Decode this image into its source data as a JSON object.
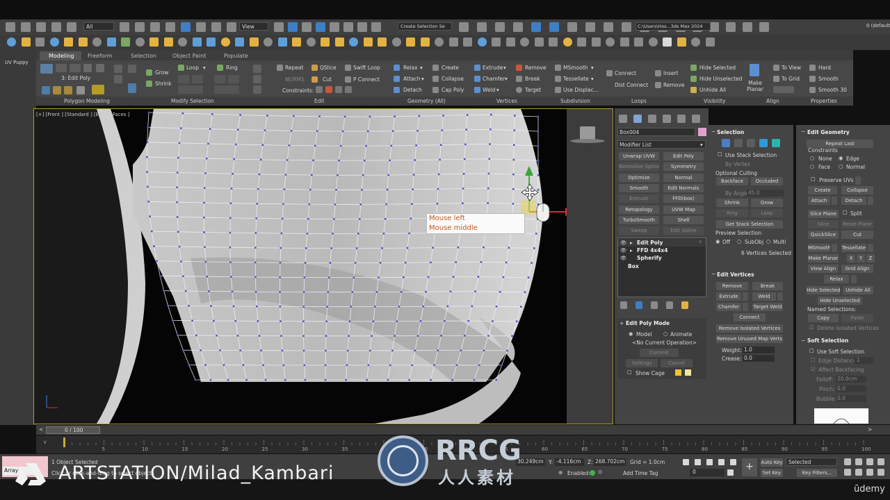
{
  "toolbar1": {
    "filter": "All",
    "view": "View",
    "selection_set": "Create Selection Se",
    "project_path": "C:\\Users\\Hos...3ds Max 2024",
    "user_count": "0 (default)"
  },
  "left_panel": {
    "label": "UV Puppy"
  },
  "ribbon": {
    "tabs": [
      "Modeling",
      "Freeform",
      "Selection",
      "Object Paint",
      "Populate"
    ],
    "edit_poly_label": "3: Edit Poly",
    "grow": "Grow",
    "shrink": "Shrink",
    "loop": "Loop",
    "ring": "Ring",
    "repeat": "Repeat",
    "qslice": "QSlice",
    "swift_loop": "Swift Loop",
    "nurms": "NURMS",
    "cut": "Cut",
    "p_connect": "P Connect",
    "constraints": "Constraints:",
    "relax": "Relax",
    "create": "Create",
    "attach": "Attach",
    "collapse": "Collapse",
    "detach": "Detach",
    "cap_poly": "Cap Poly",
    "extrude": "Extrude",
    "remove": "Remove",
    "chamfer": "Chamfer",
    "break": "Break",
    "weld": "Weld",
    "target": "Target",
    "msmooth": "MSmooth",
    "tessellate": "Tessellate",
    "use_displac": "Use Displac...",
    "connect": "Connect",
    "dist_connect": "Dist Connect",
    "insert": "Insert",
    "remove2": "Remove",
    "hide_selected": "Hide Selected",
    "hide_unselected": "Hide Unselected",
    "unhide_all": "Unhide All",
    "make_planar": "Make Planar",
    "to_view": "To View",
    "to_grid": "To Grid",
    "hard": "Hard",
    "smooth": "Smooth",
    "smooth30": "Smooth 30",
    "groups": [
      "Polygon Modeling",
      "Modify Selection",
      "Edit",
      "Geometry (All)",
      "Vertices",
      "Subdivision",
      "Loops",
      "Visibility",
      "Align",
      "Properties"
    ]
  },
  "viewport": {
    "label": "[+] [Front ] [Standard ] [Edged Faces ]",
    "tooltip_left": "Mouse left",
    "tooltip_middle": "Mouse middle"
  },
  "modifier_panel": {
    "object_name": "Box004",
    "modifier_list": "Modifier List",
    "buttons": [
      "Unwrap UVW",
      "Edit Poly",
      "Normalize Spline",
      "Symmetry",
      "Optimize",
      "Normal",
      "Smooth",
      "Edit Normals",
      "Extrude",
      "FFD(box)",
      "Retopology",
      "UVW Map",
      "TurboSmooth",
      "Shell",
      "Sweep",
      "Edit Spline"
    ],
    "stack": [
      "Edit Poly",
      "FFD 4x4x4",
      "Spherify",
      "Box"
    ],
    "edit_poly_mode": "Edit Poly Mode",
    "model": "Model",
    "animate": "Animate",
    "no_current_op": "<No Current Operation>",
    "commit": "Commit",
    "settings": "Settings",
    "cancel": "Cancel",
    "show_cage": "Show Cage"
  },
  "selection_panel": {
    "title": "Selection",
    "use_stack": "Use Stack Selection",
    "by_vertex": "By Vertex",
    "optional_culling": "Optional Culling",
    "backface": "Backface",
    "occluded": "Occluded",
    "by_angle": "By Angle:",
    "angle_value": "45.0",
    "shrink": "Shrink",
    "grow": "Grow",
    "ring": "Ring",
    "loop": "Loop",
    "get_stack": "Get Stack Selection",
    "preview_selection": "Preview Selection",
    "off": "Off",
    "subobj": "SubObj",
    "multi": "Multi",
    "status": "6 Vertices Selected",
    "edit_vertices": "Edit Vertices",
    "remove": "Remove",
    "break": "Break",
    "extrude": "Extrude",
    "weld": "Weld",
    "chamfer": "Chamfer",
    "target_weld": "Target Weld",
    "connect": "Connect",
    "remove_isolated": "Remove Isolated Vertices",
    "remove_unused": "Remove Unused Map Verts",
    "weight_label": "Weight:",
    "weight": "1.0",
    "crease_label": "Crease:",
    "crease": "0.0"
  },
  "edit_geometry": {
    "title": "Edit Geometry",
    "repeat_last": "Repeat Last",
    "constraints": "Constraints",
    "none": "None",
    "edge": "Edge",
    "face": "Face",
    "normal": "Normal",
    "preserve_uvs": "Preserve UVs",
    "create": "Create",
    "collapse": "Collapse",
    "attach": "Attach",
    "detach": "Detach",
    "slice_plane": "Slice Plane",
    "split": "Split",
    "slice": "Slice",
    "reset_plane": "Reset Plane",
    "quickslice": "QuickSlice",
    "cut": "Cut",
    "msmooth": "MSmooth",
    "tessellate": "Tessellate",
    "make_planar": "Make Planar",
    "x": "X",
    "y": "Y",
    "z": "Z",
    "view_align": "View Align",
    "grid_align": "Grid Align",
    "relax": "Relax",
    "hide_selected": "Hide Selected",
    "unhide_all": "Unhide All",
    "hide_unselected": "Hide Unselected",
    "named_selections": "Named Selections:",
    "copy": "Copy",
    "paste": "Paste",
    "delete_isolated": "Delete Isolated Vertices",
    "soft_selection": "Soft Selection",
    "use_soft": "Use Soft Selection",
    "edge_distance": "Edge Distance:",
    "edge_distance_val": "1",
    "affect_backfacing": "Affect Backfacing",
    "falloff": "Falloff:",
    "falloff_val": "20.0cm",
    "pinch": "Pinch:",
    "pinch_val": "0.0",
    "bubble": "Bubble:",
    "bubble_val": "0.0"
  },
  "timeline": {
    "frame": "0 / 100",
    "ticks": [
      "5",
      "10",
      "15",
      "20",
      "25",
      "30",
      "35",
      "40",
      "45",
      "50",
      "55",
      "60",
      "65",
      "70",
      "75",
      "80",
      "85",
      "90",
      "95",
      "100"
    ]
  },
  "status": {
    "array": "Array",
    "selected": "1 Object Selected",
    "hint": "Click or click-and-drag to select objects",
    "x": "30.249cm",
    "y_label": "Y:",
    "y": "-4.116cm",
    "z_label": "Z:",
    "z": "268.702cm",
    "grid": "Grid = 1.0cm",
    "enabled": "Enabled:",
    "add_time_tag": "Add Time Tag",
    "frame_field": "0",
    "auto_key": "Auto Key",
    "set_key": "Set Key",
    "selected_dd": "Selected",
    "key_filters": "Key Filters..."
  },
  "watermark": {
    "artstation": "ARTSTATION/Milad_Kambari",
    "rrcg": "RRCG",
    "rrcg_cn": "人人素材",
    "udemy": "ūdemy"
  }
}
